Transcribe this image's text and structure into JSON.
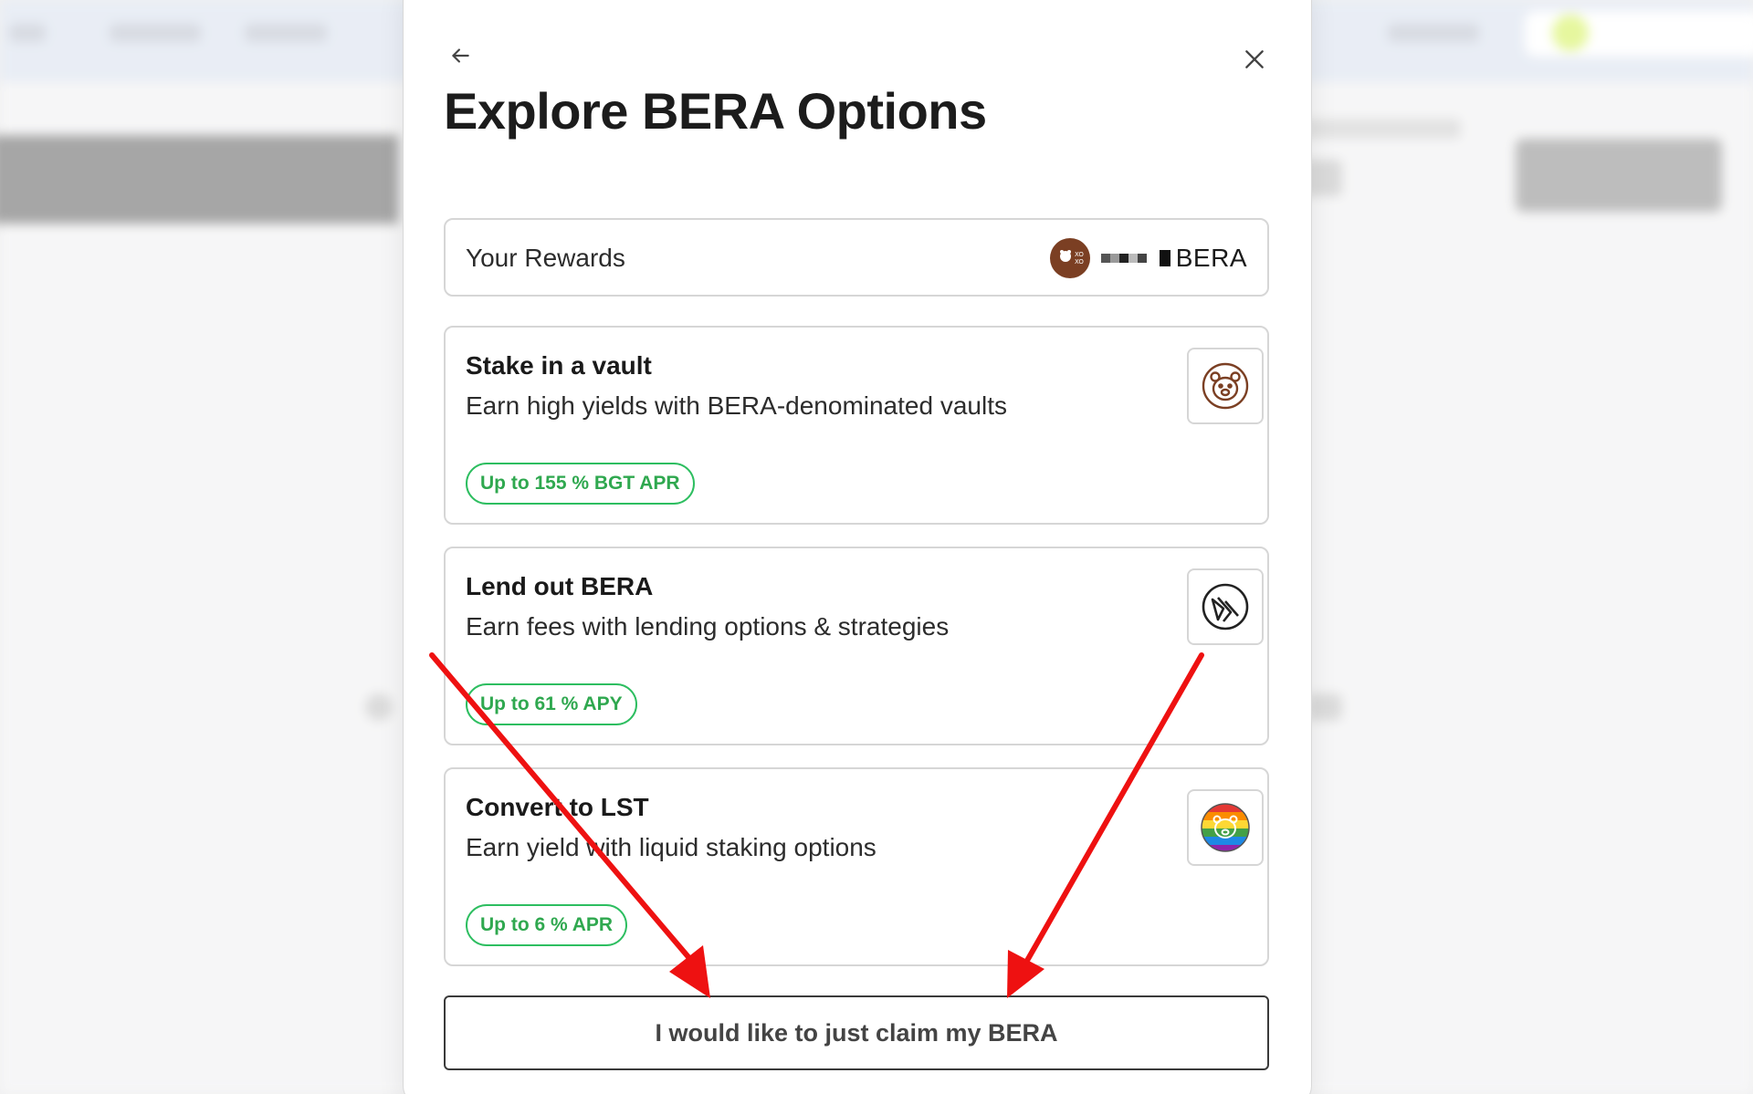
{
  "modal": {
    "title": "Explore BERA Options",
    "back_icon": "arrow-left-icon",
    "close_icon": "close-icon"
  },
  "rewards": {
    "label": "Your Rewards",
    "token": "BERA",
    "token_icon": "bera-token-icon"
  },
  "options": [
    {
      "title": "Stake in a vault",
      "description": "Earn high yields with BERA-denominated vaults",
      "badge": "Up to 155 % BGT APR",
      "icon": "bear-face-icon"
    },
    {
      "title": "Lend out BERA",
      "description": "Earn fees with lending options & strategies",
      "badge": "Up to 61 % APY",
      "icon": "lending-protocol-icon"
    },
    {
      "title": "Convert to LST",
      "description": "Earn yield with liquid staking options",
      "badge": "Up to 6 % APR",
      "icon": "rainbow-bear-icon"
    }
  ],
  "claim_button": {
    "label": "I would like to just claim my BERA"
  },
  "colors": {
    "badge_green": "#2fa84f",
    "token_brown": "#7b3f23",
    "annotation_red": "#ee1111"
  }
}
